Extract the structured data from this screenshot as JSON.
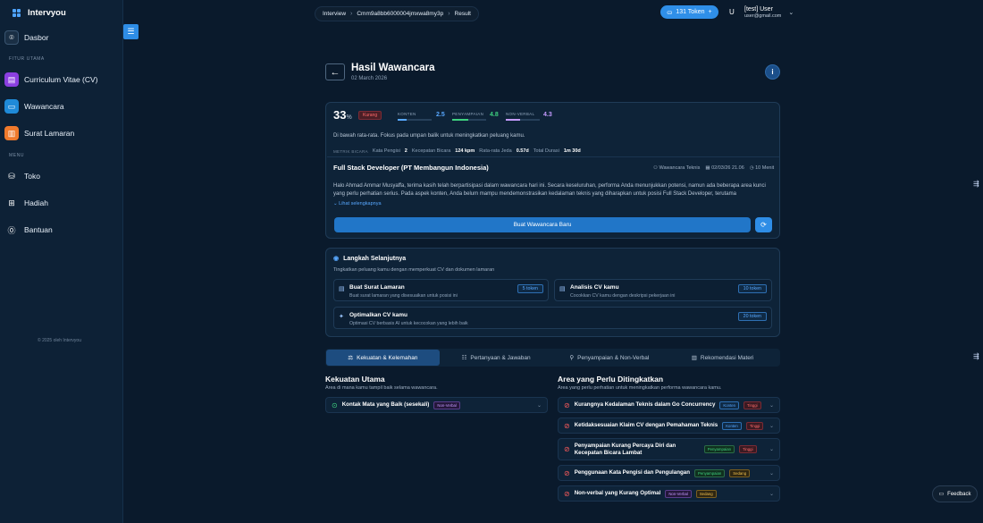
{
  "app": {
    "name": "Intervyou"
  },
  "sidebar": {
    "dashboard": "Dasbor",
    "section_main": "FITUR UTAMA",
    "cv": "Curriculum Vitae (CV)",
    "interview": "Wawancara",
    "cover_letter": "Surat Lamaran",
    "section_menu": "MENU",
    "shop": "Toko",
    "gift": "Hadiah",
    "help": "Bantuan",
    "copyright": "© 2025 oleh Intervyou"
  },
  "breadcrumb": {
    "items": [
      "Interview",
      "Cmm9a8bb6000004jmxwa8my3p",
      "Result"
    ]
  },
  "header": {
    "token_label": "131 Token",
    "user_initial": "U",
    "user_name": "[test] User",
    "user_email": "user@gmail.com"
  },
  "page": {
    "title": "Hasil Wawancara",
    "date": "02 March 2026"
  },
  "summary": {
    "score": "33",
    "percent": "%",
    "badge": "Kurang",
    "metrics": [
      {
        "label": "KONTEN",
        "value": "2.5",
        "fill": 0.25,
        "color": "#58a8ff"
      },
      {
        "label": "PENYAMPAIAN",
        "value": "4.8",
        "fill": 0.48,
        "color": "#3ed07f"
      },
      {
        "label": "NON-VERBAL",
        "value": "4.3",
        "fill": 0.43,
        "color": "#c59bff"
      }
    ],
    "text": "Di bawah rata-rata. Fokus pada umpan balik untuk meningkatkan peluang kamu.",
    "stats_head": "METRIK BICARA",
    "filler_label": "Kata Pengisi",
    "filler_value": "2",
    "speed_label": "Kecepatan Bicara",
    "speed_value": "124 kpm",
    "pause_label": "Rata-rata Jeda",
    "pause_value": "0.57d",
    "duration_label": "Total Durasi",
    "duration_value": "1m 30d"
  },
  "job": {
    "title": "Full Stack Developer (PT Membangun Indonesia)",
    "type": "Wawancara Teknis",
    "datetime": "02/03/26 21.06",
    "duration": "10 Menit",
    "body": "Halo Ahmad Ammar Musyaffa, terima kasih telah berpartisipasi dalam wawancara hari ini. Secara keseluruhan, performa Anda menunjukkan potensi, namun ada beberapa area kunci yang perlu perhatian serius. Pada aspek konten, Anda belum mampu mendemonstrasikan kedalaman teknis yang diharapkan untuk posisi Full Stack Developer, terutama",
    "more": "Lihat selengkapnya",
    "primary_button": "Buat Wawancara Baru"
  },
  "next_steps": {
    "title": "Langkah Selanjutnya",
    "subtitle": "Tingkatkan peluang kamu dengan memperkuat CV dan dokumen lamaran",
    "items": [
      {
        "title": "Buat Surat Lamaran",
        "desc": "Buat surat lamaran yang disesuaikan untuk posisi ini",
        "token": "5 token"
      },
      {
        "title": "Analisis CV kamu",
        "desc": "Cocokkan CV kamu dengan deskripsi pekerjaan ini",
        "token": "10 token"
      },
      {
        "title": "Optimalkan CV kamu",
        "desc": "Optimasi CV berbasis AI untuk kecocokan yang lebih baik",
        "token": "20 token"
      }
    ]
  },
  "tabs": [
    "Kekuatan & Kelemahan",
    "Pertanyaan & Jawaban",
    "Penyampaian & Non-Verbal",
    "Rekomendasi Materi"
  ],
  "strengths": {
    "title": "Kekuatan Utama",
    "subtitle": "Area di mana kamu tampil baik selama wawancara.",
    "items": [
      {
        "title": "Kontak Mata yang Baik (sesekali)",
        "tag": "Non-Verbal"
      }
    ]
  },
  "improve": {
    "title": "Area yang Perlu Ditingkatkan",
    "subtitle": "Area yang perlu perhatian untuk meningkatkan performa wawancara kamu.",
    "items": [
      {
        "title": "Kurangnya Kedalaman Teknis dalam Go Concurrency",
        "cat": "Konten",
        "level": "Tinggi"
      },
      {
        "title": "Ketidaksesuaian Klaim CV dengan Pemahaman Teknis",
        "cat": "Konten",
        "level": "Tinggi"
      },
      {
        "title": "Penyampaian Kurang Percaya Diri dan Kecepatan Bicara Lambat",
        "cat": "Penyampaian",
        "level": "Tinggi"
      },
      {
        "title": "Penggunaan Kata Pengisi dan Pengulangan",
        "cat": "Penyampaian",
        "level": "Sedang"
      },
      {
        "title": "Non-verbal yang Kurang Optimal",
        "cat": "Non-Verbal",
        "level": "Sedang"
      }
    ]
  },
  "feedback": "Feedback"
}
